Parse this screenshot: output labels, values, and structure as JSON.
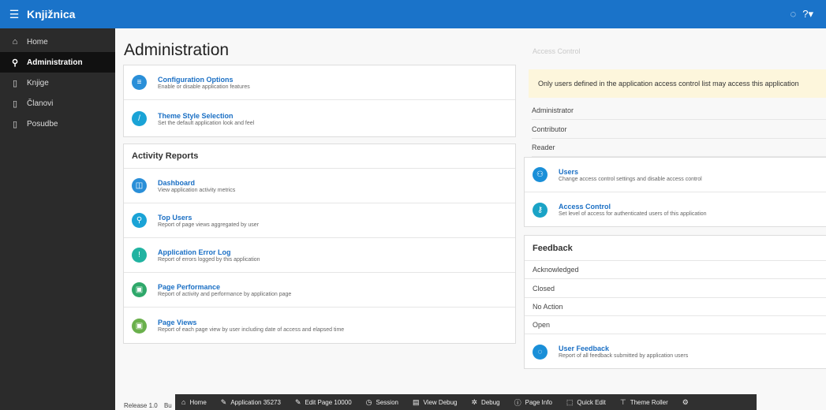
{
  "app": {
    "title": "Knjižnica",
    "menu_icon": "hamburger-icon"
  },
  "header_icons": {
    "feedback": "chat-icon",
    "help": "help-icon"
  },
  "sidebar": {
    "items": [
      {
        "label": "Home",
        "icon": "home-icon"
      },
      {
        "label": "Administration",
        "icon": "admin-icon"
      },
      {
        "label": "Knjige",
        "icon": "page-icon"
      },
      {
        "label": "Članovi",
        "icon": "page-icon"
      },
      {
        "label": "Posudbe",
        "icon": "page-icon"
      }
    ]
  },
  "main": {
    "title": "Administration",
    "config": {
      "items": [
        {
          "title": "Configuration Options",
          "desc": "Enable or disable application features",
          "color": "#2a8fd8"
        },
        {
          "title": "Theme Style Selection",
          "desc": "Set the default application look and feel",
          "color": "#1aa3d6"
        }
      ]
    },
    "activity": {
      "heading": "Activity Reports",
      "items": [
        {
          "title": "Dashboard",
          "desc": "View application activity metrics",
          "color": "#2a8fd8"
        },
        {
          "title": "Top Users",
          "desc": "Report of page views aggregated by user",
          "color": "#1aa3d6"
        },
        {
          "title": "Application Error Log",
          "desc": "Report of errors logged by this application",
          "color": "#21b3a1"
        },
        {
          "title": "Page Performance",
          "desc": "Report of activity and performance by application page",
          "color": "#2ea86a"
        },
        {
          "title": "Page Views",
          "desc": "Report of each page view by user including date of access and elapsed time",
          "color": "#6ab04c"
        }
      ]
    },
    "access_control": {
      "heading": "Access Control",
      "notice": "Only users defined in the application access control list may access this application",
      "roles": [
        "Administrator",
        "Contributor",
        "Reader"
      ],
      "links": [
        {
          "title": "Users",
          "desc": "Change access control settings and disable access control",
          "color": "#1a8fd8"
        },
        {
          "title": "Access Control",
          "desc": "Set level of access for authenticated users of this application",
          "color": "#1aa3c6"
        }
      ]
    },
    "feedback": {
      "heading": "Feedback",
      "statuses": [
        "Acknowledged",
        "Closed",
        "No Action",
        "Open"
      ],
      "link": {
        "title": "User Feedback",
        "desc": "Report of all feedback submitted by application users",
        "color": "#1a8fd8"
      }
    }
  },
  "footer": {
    "release": "Release 1.0",
    "build": "Bu"
  },
  "devbar": {
    "items": [
      {
        "label": "Home",
        "icon": "⌂"
      },
      {
        "label": "Application 35273",
        "icon": "✎"
      },
      {
        "label": "Edit Page 10000",
        "icon": "✎"
      },
      {
        "label": "Session",
        "icon": "◷"
      },
      {
        "label": "View Debug",
        "icon": "▤"
      },
      {
        "label": "Debug",
        "icon": "✲"
      },
      {
        "label": "Page Info",
        "icon": "ⓘ"
      },
      {
        "label": "Quick Edit",
        "icon": "⬚"
      },
      {
        "label": "Theme Roller",
        "icon": "⊤"
      },
      {
        "label": "",
        "icon": "⚙"
      }
    ]
  }
}
